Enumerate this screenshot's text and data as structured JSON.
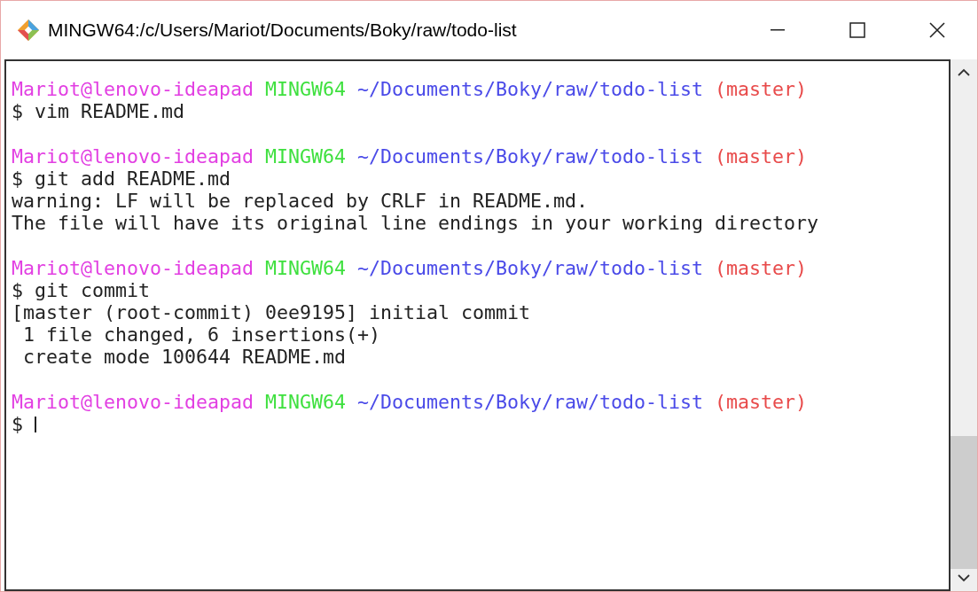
{
  "window": {
    "title": "MINGW64:/c/Users/Mariot/Documents/Boky/raw/todo-list"
  },
  "terminal": {
    "lines": [
      {
        "kind": "prompt",
        "segments": [
          {
            "kind": "user",
            "text": "Mariot@lenovo-ideapad"
          },
          {
            "kind": "shell",
            "text": "MINGW64"
          },
          {
            "kind": "path",
            "text": "~/Documents/Boky/raw/todo-list"
          },
          {
            "kind": "branch",
            "text": "(master)"
          }
        ]
      },
      {
        "kind": "command",
        "text": "$ vim README.md",
        "cursor": false
      },
      {
        "kind": "blank"
      },
      {
        "kind": "prompt",
        "segments": [
          {
            "kind": "user",
            "text": "Mariot@lenovo-ideapad"
          },
          {
            "kind": "shell",
            "text": "MINGW64"
          },
          {
            "kind": "path",
            "text": "~/Documents/Boky/raw/todo-list"
          },
          {
            "kind": "branch",
            "text": "(master)"
          }
        ]
      },
      {
        "kind": "command",
        "text": "$ git add README.md",
        "cursor": false
      },
      {
        "kind": "output",
        "text": "warning: LF will be replaced by CRLF in README.md."
      },
      {
        "kind": "output",
        "text": "The file will have its original line endings in your working directory"
      },
      {
        "kind": "blank"
      },
      {
        "kind": "prompt",
        "segments": [
          {
            "kind": "user",
            "text": "Mariot@lenovo-ideapad"
          },
          {
            "kind": "shell",
            "text": "MINGW64"
          },
          {
            "kind": "path",
            "text": "~/Documents/Boky/raw/todo-list"
          },
          {
            "kind": "branch",
            "text": "(master)"
          }
        ]
      },
      {
        "kind": "command",
        "text": "$ git commit",
        "cursor": false
      },
      {
        "kind": "output",
        "text": "[master (root-commit) 0ee9195] initial commit"
      },
      {
        "kind": "output",
        "text": " 1 file changed, 6 insertions(+)"
      },
      {
        "kind": "output",
        "text": " create mode 100644 README.md"
      },
      {
        "kind": "blank"
      },
      {
        "kind": "prompt",
        "segments": [
          {
            "kind": "user",
            "text": "Mariot@lenovo-ideapad"
          },
          {
            "kind": "shell",
            "text": "MINGW64"
          },
          {
            "kind": "path",
            "text": "~/Documents/Boky/raw/todo-list"
          },
          {
            "kind": "branch",
            "text": "(master)"
          }
        ]
      },
      {
        "kind": "command",
        "text": "$",
        "cursor": true
      }
    ]
  }
}
